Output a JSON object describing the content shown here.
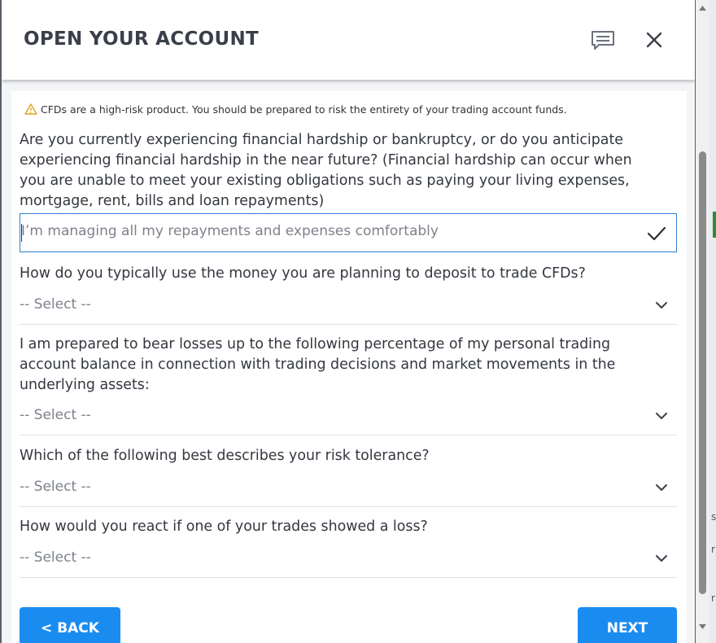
{
  "dialog": {
    "title": "OPEN YOUR ACCOUNT",
    "icons": {
      "chat": "chat-icon",
      "close": "close-icon"
    }
  },
  "warning": {
    "icon": "warning-icon",
    "color": "#e0a020",
    "text": "CFDs are a high-risk product. You should be prepared to risk the entirety of your trading account funds."
  },
  "questions": [
    {
      "lines": [
        "Are you currently experiencing financial hardship or bankruptcy, or do you anticipate",
        "experiencing financial hardship in the near future? (Financial hardship can occur when",
        "you are unable to meet your existing obligations such as paying your living expenses,",
        "mortgage, rent, bills and loan repayments)"
      ],
      "answer": "I’m managing all my repayments and expenses comfortably"
    },
    {
      "lines": [
        "How do you typically use the money you are planning to deposit to trade CFDs?"
      ],
      "answer": "-- Select --"
    },
    {
      "lines": [
        "I am prepared to bear losses up to the following percentage of my personal trading",
        "account balance in connection with trading decisions and market movements in the",
        "underlying assets:"
      ],
      "answer": "-- Select --"
    },
    {
      "lines": [
        "Which of the following best describes your risk tolerance?"
      ],
      "answer": "-- Select --"
    },
    {
      "lines": [
        "How would you react if one of your trades showed a loss?"
      ],
      "answer": "-- Select --"
    }
  ],
  "buttons": {
    "back": "< BACK",
    "next": "NEXT"
  },
  "colors": {
    "accent": "#1a8cf0",
    "focus_border": "#2f80d0",
    "title": "#3a3f4a"
  },
  "background": {
    "edge_chars": [
      "s",
      "r",
      "r"
    ]
  }
}
